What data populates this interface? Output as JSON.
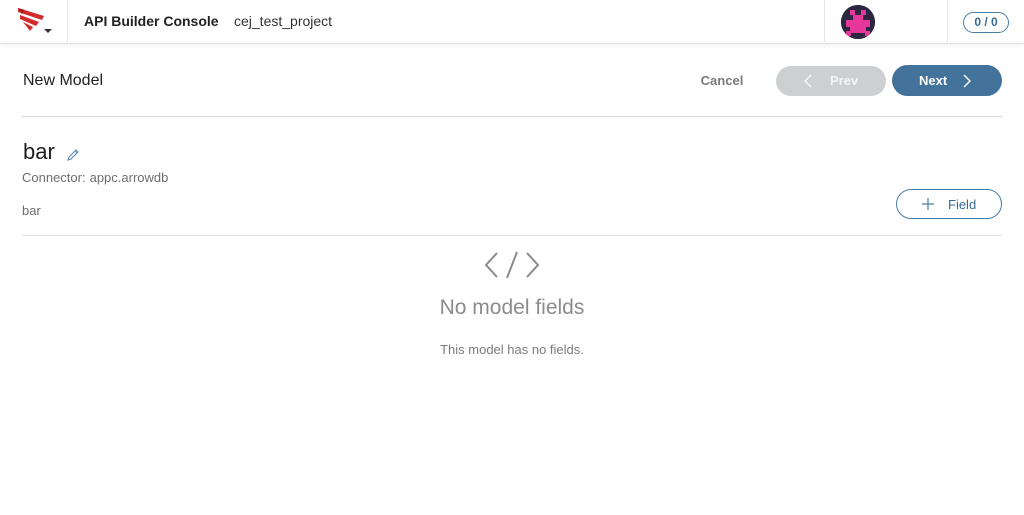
{
  "topbar": {
    "app_title": "API Builder Console",
    "project_name": "cej_test_project",
    "counter": "0 / 0",
    "logo_icon": "axway-logo-icon",
    "avatar_icon": "user-avatar-icon"
  },
  "header": {
    "page_title": "New Model",
    "cancel_label": "Cancel",
    "prev_label": "Prev",
    "next_label": "Next"
  },
  "model": {
    "name": "bar",
    "connector_label": "Connector:",
    "connector_value": "appc.arrowdb",
    "description": "bar",
    "add_field_label": "Field"
  },
  "empty_state": {
    "icon": "code-brackets-icon",
    "title": "No model fields",
    "subtitle": "This model has no fields."
  },
  "colors": {
    "accent": "#43739a",
    "brand_red": "#d22b2b",
    "disabled": "#cdcfd1"
  }
}
